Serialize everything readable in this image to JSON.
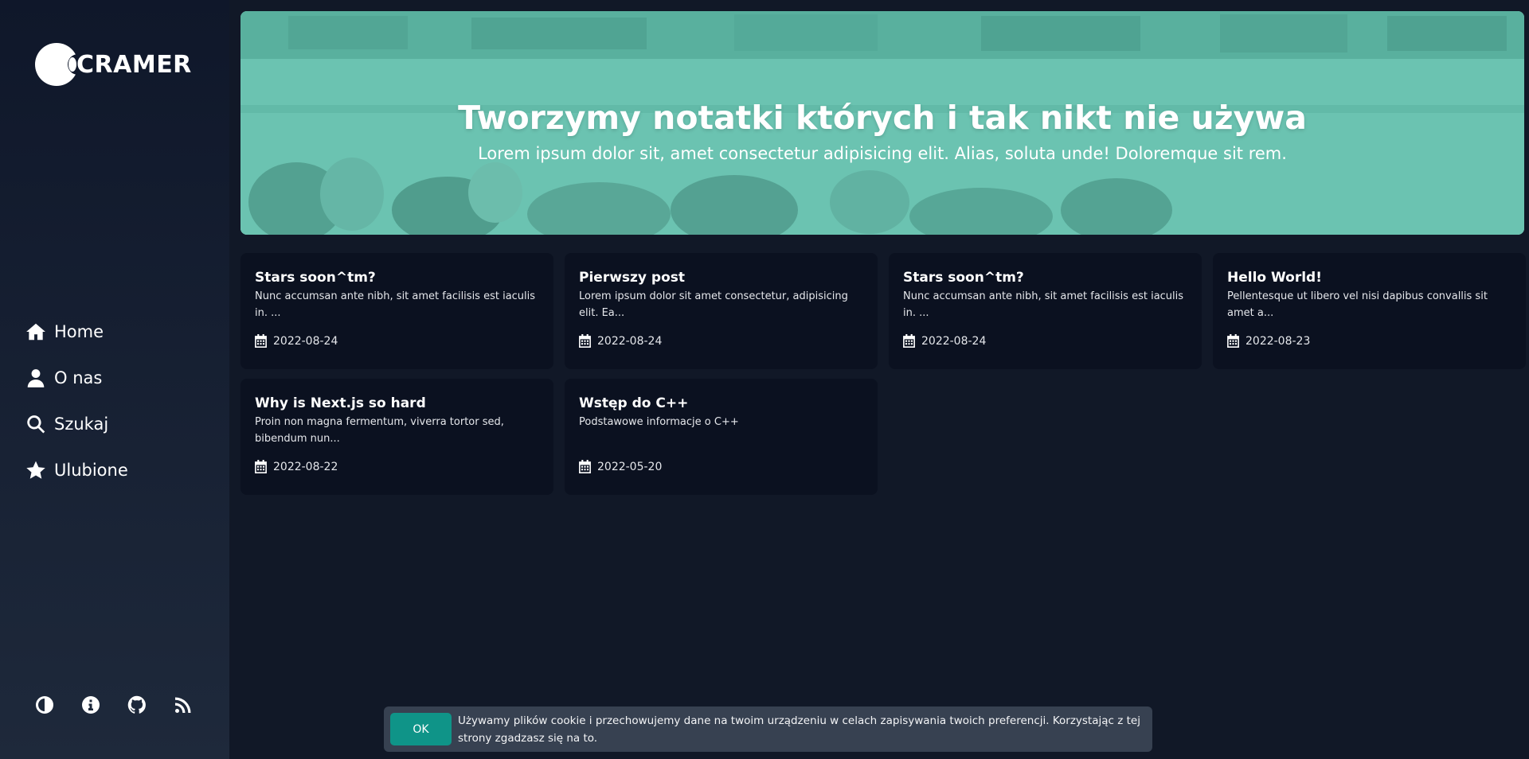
{
  "brand": {
    "name": "CRAMER"
  },
  "sidebar": {
    "nav": [
      {
        "label": "Home",
        "icon": "home-icon"
      },
      {
        "label": "O nas",
        "icon": "user-icon"
      },
      {
        "label": "Szukaj",
        "icon": "search-icon"
      },
      {
        "label": "Ulubione",
        "icon": "star-icon"
      }
    ],
    "footer_icons": [
      "theme-toggle-icon",
      "info-icon",
      "github-icon",
      "rss-icon"
    ]
  },
  "hero": {
    "title": "Tworzymy notatki których i tak nikt nie używa",
    "subtitle": "Lorem ipsum dolor sit, amet consectetur adipisicing elit. Alias, soluta unde! Doloremque sit rem."
  },
  "posts": [
    {
      "title": "Stars soon^tm?",
      "excerpt": "Nunc accumsan ante nibh, sit amet facilisis est iaculis in. ...",
      "date": "2022-08-24"
    },
    {
      "title": "Pierwszy post",
      "excerpt": "Lorem ipsum dolor sit amet consectetur, adipisicing elit. Ea...",
      "date": "2022-08-24"
    },
    {
      "title": "Stars soon^tm?",
      "excerpt": "Nunc accumsan ante nibh, sit amet facilisis est iaculis in. ...",
      "date": "2022-08-24"
    },
    {
      "title": "Hello World!",
      "excerpt": "Pellentesque ut libero vel nisi dapibus convallis sit amet a...",
      "date": "2022-08-23"
    },
    {
      "title": "Why is Next.js so hard",
      "excerpt": "Proin non magna fermentum, viverra tortor sed, bibendum nun...",
      "date": "2022-08-22"
    },
    {
      "title": "Wstęp do C++",
      "excerpt": "Podstawowe informacje o C++",
      "date": "2022-05-20"
    }
  ],
  "cookie": {
    "button_label": "OK",
    "text": "Używamy plików cookie i przechowujemy dane na twoim urządzeniu w celach zapisywania twoich preferencji. Korzystając z tej strony zgadzasz się na to."
  },
  "colors": {
    "background": "#111827",
    "sidebar": "#0f172a",
    "card": "#0b1120",
    "accent": "#0f9488",
    "hero_tint": "#58bca8",
    "cookie_bar": "#374151"
  }
}
